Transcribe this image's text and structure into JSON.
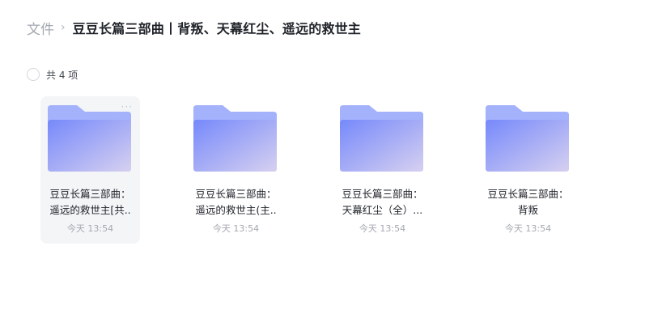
{
  "breadcrumb": {
    "root": "文件",
    "separator": "›",
    "current": "豆豆长篇三部曲丨背叛、天幕红尘、遥远的救世主"
  },
  "selection": {
    "count_label": "共 4 项"
  },
  "colors": {
    "folder_back": "#9fb0fb",
    "folder_front_start": "#7b8cfa",
    "folder_front_end": "#d3cdf0",
    "hover_bg": "#f4f5f7"
  },
  "files": [
    {
      "icon": "folder-icon",
      "title_line1": "豆豆长篇三部曲：",
      "title_line2": "遥远的救世主[共..",
      "time": "今天 13:54",
      "hovered": true
    },
    {
      "icon": "folder-icon",
      "title_line1": "豆豆长篇三部曲：",
      "title_line2": "遥远的救世主(主..",
      "time": "今天 13:54",
      "hovered": false
    },
    {
      "icon": "folder-icon",
      "title_line1": "豆豆长篇三部曲：",
      "title_line2": "天幕红尘（全）...",
      "time": "今天 13:54",
      "hovered": false
    },
    {
      "icon": "folder-icon",
      "title_line1": "豆豆长篇三部曲：",
      "title_line2": "背叛",
      "time": "今天 13:54",
      "hovered": false
    }
  ]
}
